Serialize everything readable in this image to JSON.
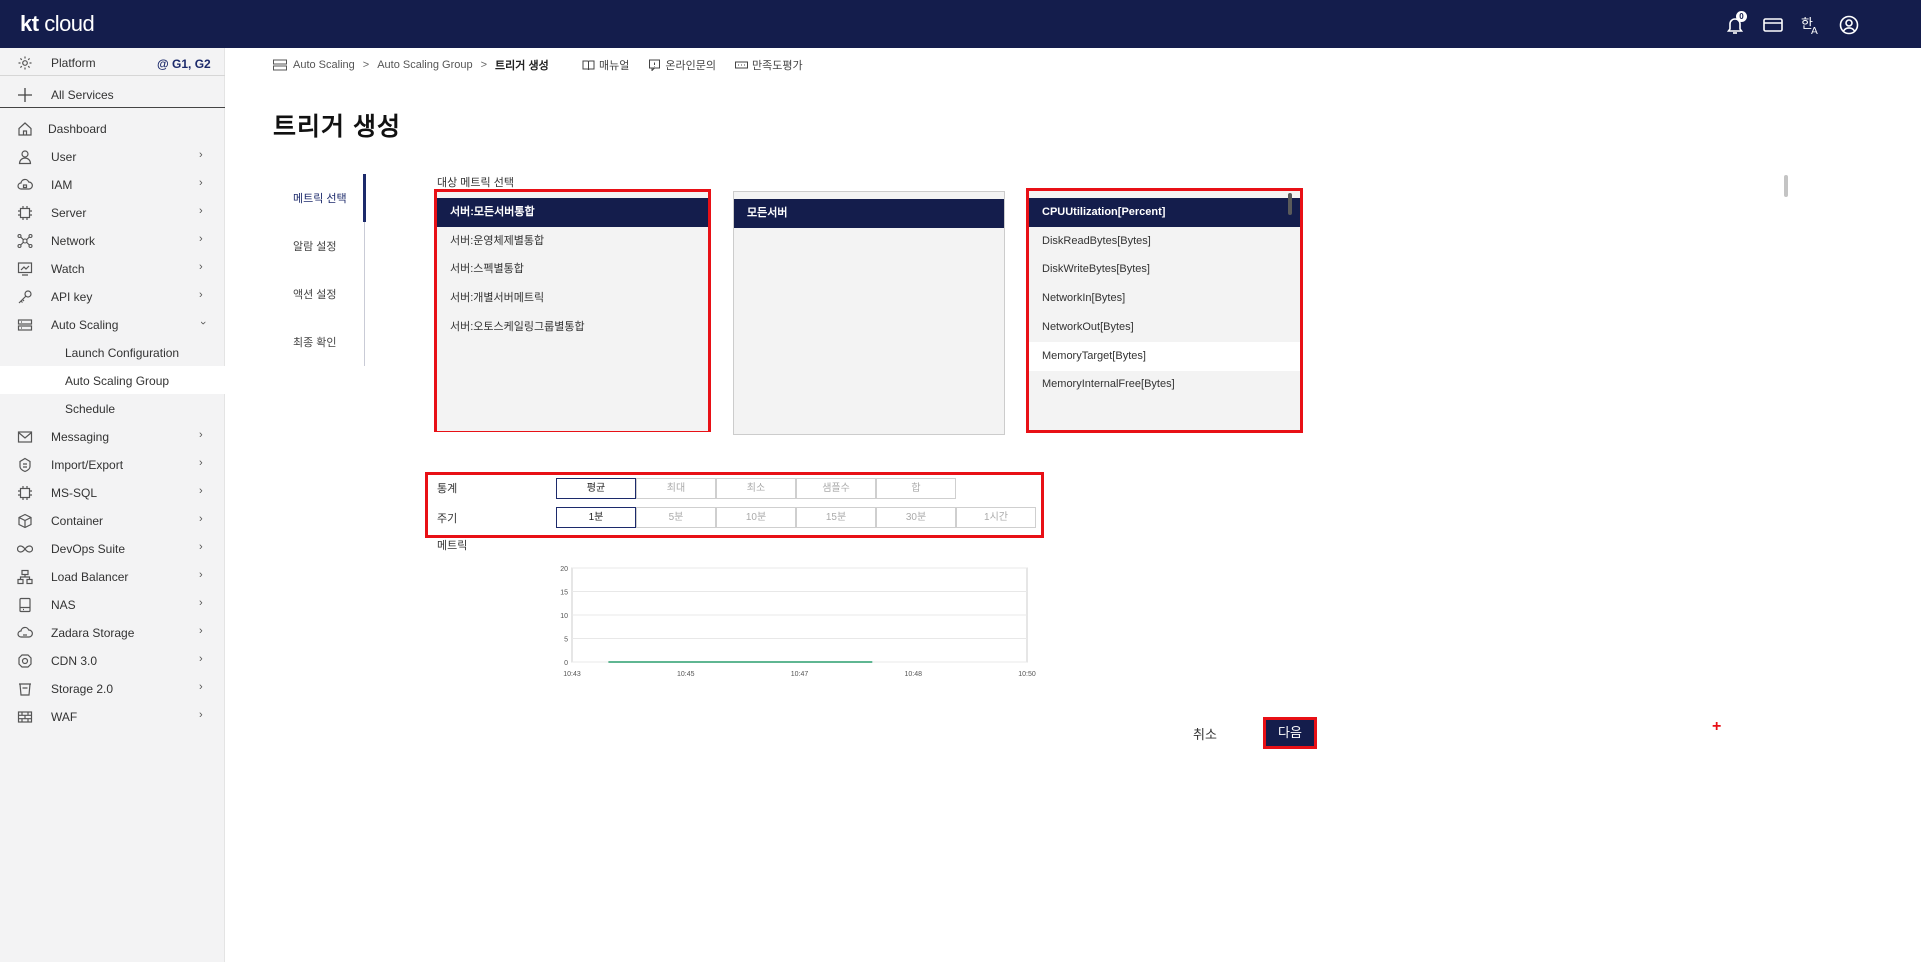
{
  "header": {
    "logo_kt": "kt",
    "logo_cloud": "cloud",
    "notification_count": "0"
  },
  "sidebar": {
    "platform_label": "Platform",
    "platform_tag": "@ G1, G2",
    "all_services": "All Services",
    "items": [
      {
        "label": "Dashboard",
        "icon": "home-icon"
      },
      {
        "label": "User",
        "icon": "user-icon"
      },
      {
        "label": "IAM",
        "icon": "cloud-lock-icon"
      },
      {
        "label": "Server",
        "icon": "chip-icon"
      },
      {
        "label": "Network",
        "icon": "network-icon"
      },
      {
        "label": "Watch",
        "icon": "monitor-chart-icon"
      },
      {
        "label": "API key",
        "icon": "key-icon"
      },
      {
        "label": "Auto Scaling",
        "icon": "server-stack-icon"
      },
      {
        "label": "Launch Configuration"
      },
      {
        "label": "Auto Scaling Group"
      },
      {
        "label": "Schedule"
      },
      {
        "label": "Messaging",
        "icon": "mail-icon"
      },
      {
        "label": "Import/Export",
        "icon": "transfer-icon"
      },
      {
        "label": "MS-SQL",
        "icon": "database-chip-icon"
      },
      {
        "label": "Container",
        "icon": "cube-icon"
      },
      {
        "label": "DevOps Suite",
        "icon": "infinity-icon"
      },
      {
        "label": "Load Balancer",
        "icon": "load-balancer-icon"
      },
      {
        "label": "NAS",
        "icon": "storage-icon"
      },
      {
        "label": "Zadara Storage",
        "icon": "cloud-storage-icon"
      },
      {
        "label": "CDN 3.0",
        "icon": "cdn-icon"
      },
      {
        "label": "Storage 2.0",
        "icon": "bucket-icon"
      },
      {
        "label": "WAF",
        "icon": "firewall-icon"
      }
    ]
  },
  "breadcrumb": {
    "items": [
      "Auto Scaling",
      "Auto Scaling Group",
      "트리거 생성"
    ],
    "separator": ">"
  },
  "help_links": [
    "매뉴얼",
    "온라인문의",
    "만족도평가"
  ],
  "page_title": "트리거 생성",
  "steps": [
    "메트릭 선택",
    "알람 설정",
    "액션 설정",
    "최종 확인"
  ],
  "metric_select_label": "대상 메트릭 선택",
  "list1": [
    "서버:모든서버통합",
    "서버:운영체제별통합",
    "서버:스펙별통합",
    "서버:개별서버메트릭",
    "서버:오토스케일링그룹별통합"
  ],
  "list2": [
    "모든서버"
  ],
  "list3": [
    "CPUUtilization[Percent]",
    "DiskReadBytes[Bytes]",
    "DiskWriteBytes[Bytes]",
    "NetworkIn[Bytes]",
    "NetworkOut[Bytes]",
    "MemoryTarget[Bytes]",
    "MemoryInternalFree[Bytes]"
  ],
  "stat": {
    "label": "통계",
    "options": [
      "평균",
      "최대",
      "최소",
      "샘플수",
      "합"
    ],
    "selected": "평균"
  },
  "period": {
    "label": "주기",
    "options": [
      "1분",
      "5분",
      "10분",
      "15분",
      "30분",
      "1시간"
    ],
    "selected": "1분"
  },
  "metric_chart_label": "메트릭",
  "chart_data": {
    "type": "line",
    "y_ticks": [
      "20",
      "15",
      "10",
      "5",
      "0"
    ],
    "x_ticks": [
      "10:43",
      "10:45",
      "10:47",
      "10:48",
      "10:50"
    ],
    "ylim": [
      0,
      20
    ],
    "series": [
      {
        "values": [
          0,
          0,
          0,
          0
        ],
        "color": "#2a9d6f"
      }
    ]
  },
  "actions": {
    "cancel": "취소",
    "next": "다음"
  },
  "colors": {
    "navy": "#141d4c",
    "highlight": "#e81016"
  }
}
